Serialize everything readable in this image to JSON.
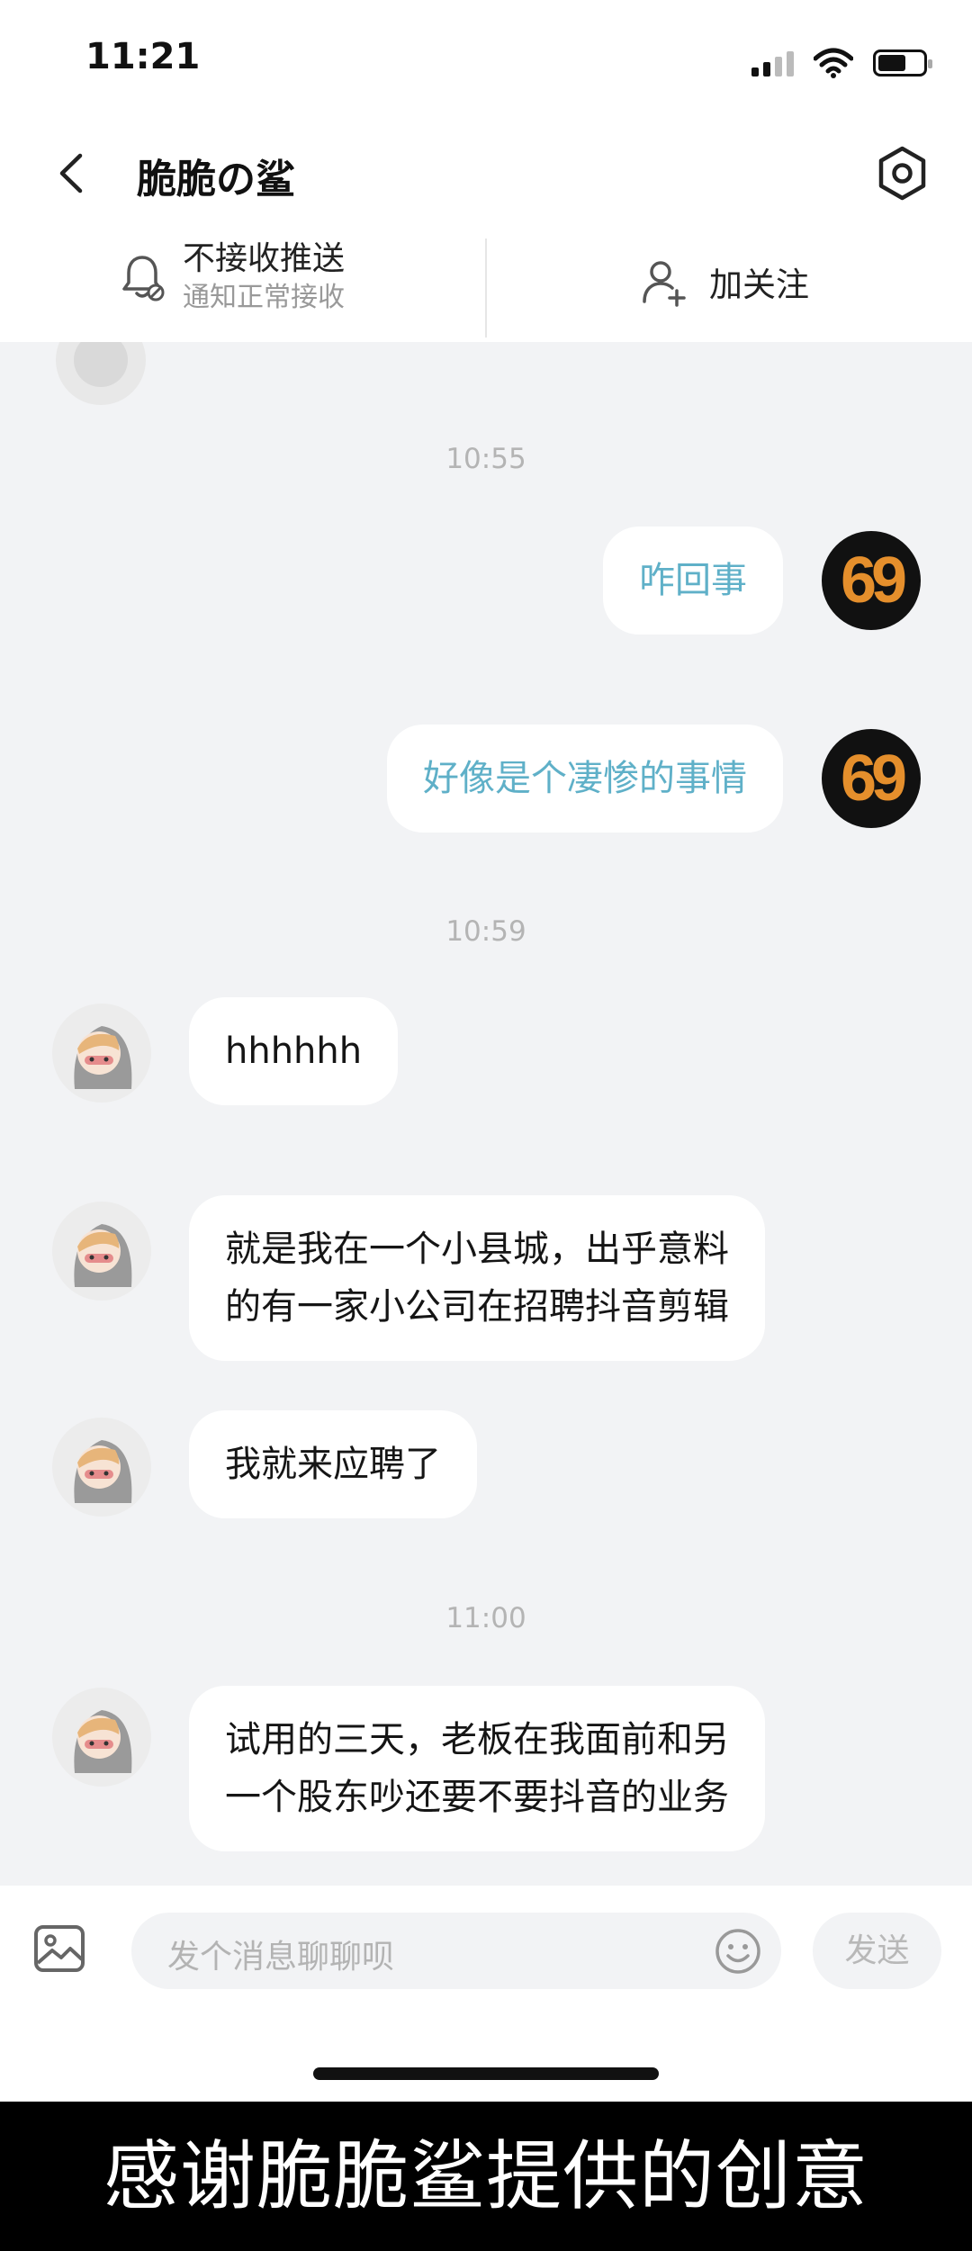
{
  "status_bar": {
    "time": "11:21"
  },
  "header": {
    "title": "脆脆の鲨"
  },
  "subscription": {
    "push_label": "不接收推送",
    "push_sub": "通知正常接收",
    "follow_label": "加关注"
  },
  "chat": {
    "timestamps": [
      "10:55",
      "10:59",
      "11:00"
    ],
    "avatar_text": "69",
    "messages": [
      {
        "dir": "out",
        "text": "咋回事"
      },
      {
        "dir": "out",
        "text": "好像是个凄惨的事情"
      },
      {
        "dir": "in",
        "text": "hhhhhh"
      },
      {
        "dir": "in",
        "lines": [
          "就是我在一个小县城，出乎意料",
          "的有一家小公司在招聘抖音剪辑"
        ]
      },
      {
        "dir": "in",
        "text": "我就来应聘了"
      },
      {
        "dir": "in",
        "lines": [
          "试用的三天，老板在我面前和另",
          "一个股东吵还要不要抖音的业务"
        ]
      }
    ]
  },
  "input": {
    "placeholder": "发个消息聊聊呗",
    "send_label": "发送"
  },
  "caption": "感谢脆脆鲨提供的创意",
  "colors": {
    "outgoing_text": "#5fb0c8",
    "chat_bg": "#f2f3f5",
    "avatar_num": "#e58f2c"
  },
  "icons": [
    "back-icon",
    "settings-icon",
    "bell-off-icon",
    "add-user-icon",
    "image-icon",
    "emoji-icon"
  ]
}
